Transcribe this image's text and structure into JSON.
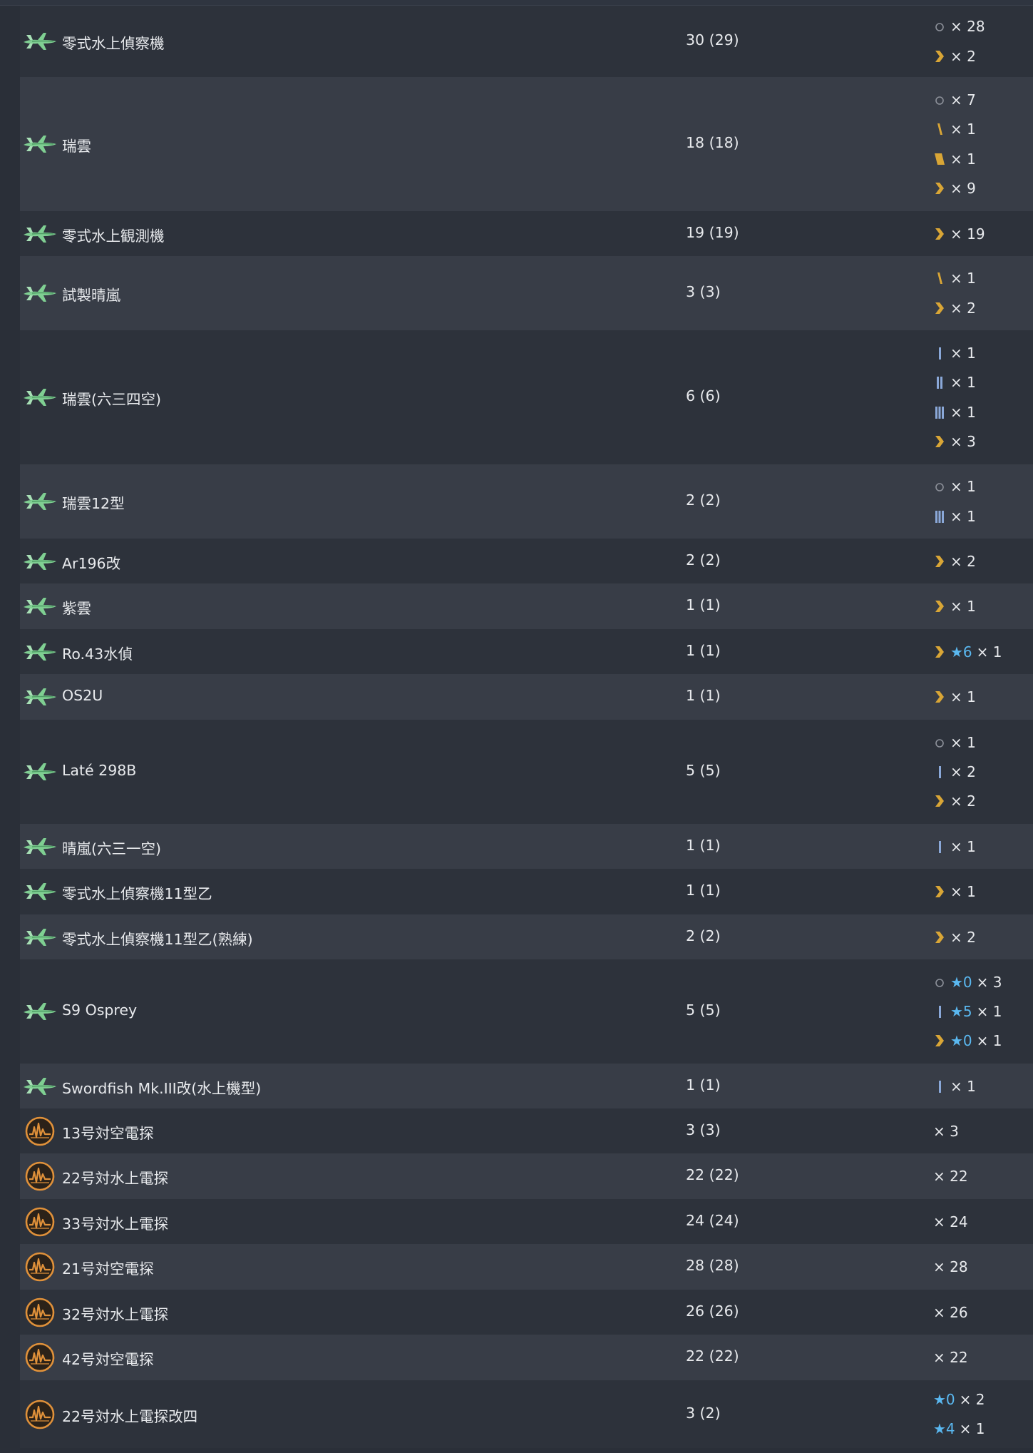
{
  "colors": {
    "row_odd": "#2d323b",
    "row_even": "#383d47",
    "text": "#e8eaed",
    "star": "#5ab8f0",
    "seaplane_icon": "#7fcf92",
    "radar_icon": "#e0913a",
    "prof_gold": "#d9a636",
    "prof_blue": "#8aa8d8",
    "prof_zero": "#8c9099"
  },
  "rows": [
    {
      "icon": "seaplane-icon",
      "name": "零式水上偵察機",
      "count": "30 (29)",
      "prof": [
        {
          "mark": "zero",
          "times": "× 28"
        },
        {
          "mark": "chevron",
          "times": "× 2"
        }
      ]
    },
    {
      "icon": "seaplane-icon",
      "name": "瑞雲",
      "count": "18 (18)",
      "prof": [
        {
          "mark": "zero",
          "times": "× 7"
        },
        {
          "mark": "gold-1",
          "times": "× 1"
        },
        {
          "mark": "gold-2",
          "times": "× 1"
        },
        {
          "mark": "chevron",
          "times": "× 9"
        }
      ]
    },
    {
      "icon": "seaplane-icon",
      "name": "零式水上観測機",
      "count": "19 (19)",
      "prof": [
        {
          "mark": "chevron",
          "times": "× 19"
        }
      ]
    },
    {
      "icon": "seaplane-icon",
      "name": "試製晴嵐",
      "count": "3 (3)",
      "prof": [
        {
          "mark": "gold-1",
          "times": "× 1"
        },
        {
          "mark": "chevron",
          "times": "× 2"
        }
      ]
    },
    {
      "icon": "seaplane-icon",
      "name": "瑞雲(六三四空)",
      "count": "6 (6)",
      "prof": [
        {
          "mark": "blue-1",
          "times": "× 1"
        },
        {
          "mark": "blue-2",
          "times": "× 1"
        },
        {
          "mark": "blue-3",
          "times": "× 1"
        },
        {
          "mark": "chevron",
          "times": "× 3"
        }
      ]
    },
    {
      "icon": "seaplane-icon",
      "name": "瑞雲12型",
      "count": "2 (2)",
      "prof": [
        {
          "mark": "zero",
          "times": "× 1"
        },
        {
          "mark": "blue-3",
          "times": "× 1"
        }
      ]
    },
    {
      "icon": "seaplane-icon",
      "name": "Ar196改",
      "count": "2 (2)",
      "prof": [
        {
          "mark": "chevron",
          "times": "× 2"
        }
      ]
    },
    {
      "icon": "seaplane-icon",
      "name": "紫雲",
      "count": "1 (1)",
      "prof": [
        {
          "mark": "chevron",
          "times": "× 1"
        }
      ]
    },
    {
      "icon": "seaplane-icon",
      "name": "Ro.43水偵",
      "count": "1 (1)",
      "prof": [
        {
          "mark": "chevron",
          "star": "★6",
          "times": "× 1"
        }
      ]
    },
    {
      "icon": "seaplane-icon",
      "name": "OS2U",
      "count": "1 (1)",
      "prof": [
        {
          "mark": "chevron",
          "times": "× 1"
        }
      ]
    },
    {
      "icon": "seaplane-icon",
      "name": "Laté 298B",
      "count": "5 (5)",
      "prof": [
        {
          "mark": "zero",
          "times": "× 1"
        },
        {
          "mark": "blue-1",
          "times": "× 2"
        },
        {
          "mark": "chevron",
          "times": "× 2"
        }
      ]
    },
    {
      "icon": "seaplane-icon",
      "name": "晴嵐(六三一空)",
      "count": "1 (1)",
      "prof": [
        {
          "mark": "blue-1",
          "times": "× 1"
        }
      ]
    },
    {
      "icon": "seaplane-icon",
      "name": "零式水上偵察機11型乙",
      "count": "1 (1)",
      "prof": [
        {
          "mark": "chevron",
          "times": "× 1"
        }
      ]
    },
    {
      "icon": "seaplane-icon",
      "name": "零式水上偵察機11型乙(熟練)",
      "count": "2 (2)",
      "prof": [
        {
          "mark": "chevron",
          "times": "× 2"
        }
      ]
    },
    {
      "icon": "seaplane-icon",
      "name": "S9 Osprey",
      "count": "5 (5)",
      "prof": [
        {
          "mark": "zero",
          "star": "★0",
          "times": "× 3"
        },
        {
          "mark": "blue-1",
          "star": "★5",
          "times": "× 1"
        },
        {
          "mark": "chevron",
          "star": "★0",
          "times": "× 1"
        }
      ]
    },
    {
      "icon": "seaplane-icon",
      "name": "Swordfish Mk.III改(水上機型)",
      "count": "1 (1)",
      "prof": [
        {
          "mark": "blue-1",
          "times": "× 1"
        }
      ]
    },
    {
      "icon": "radar-icon",
      "name": "13号対空電探",
      "count": "3 (3)",
      "prof": [
        {
          "mark": "none",
          "times": "× 3"
        }
      ]
    },
    {
      "icon": "radar-icon",
      "name": "22号対水上電探",
      "count": "22 (22)",
      "prof": [
        {
          "mark": "none",
          "times": "× 22"
        }
      ]
    },
    {
      "icon": "radar-icon",
      "name": "33号対水上電探",
      "count": "24 (24)",
      "prof": [
        {
          "mark": "none",
          "times": "× 24"
        }
      ]
    },
    {
      "icon": "radar-icon",
      "name": "21号対空電探",
      "count": "28 (28)",
      "prof": [
        {
          "mark": "none",
          "times": "× 28"
        }
      ]
    },
    {
      "icon": "radar-icon",
      "name": "32号対水上電探",
      "count": "26 (26)",
      "prof": [
        {
          "mark": "none",
          "times": "× 26"
        }
      ]
    },
    {
      "icon": "radar-icon",
      "name": "42号対空電探",
      "count": "22 (22)",
      "prof": [
        {
          "mark": "none",
          "times": "× 22"
        }
      ]
    },
    {
      "icon": "radar-icon",
      "name": "22号対水上電探改四",
      "count": "3 (2)",
      "prof": [
        {
          "mark": "none",
          "star": "★0",
          "times": "× 2"
        },
        {
          "mark": "none",
          "star": "★4",
          "times": "× 1"
        }
      ]
    }
  ]
}
